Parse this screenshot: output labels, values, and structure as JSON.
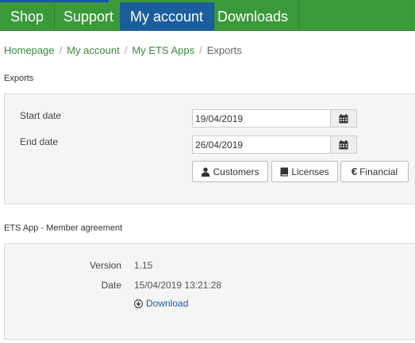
{
  "nav": {
    "items": [
      {
        "label": "Shop",
        "active": false
      },
      {
        "label": "Support",
        "active": false
      },
      {
        "label": "My account",
        "active": true
      },
      {
        "label": "Downloads",
        "active": false
      }
    ]
  },
  "breadcrumb": {
    "items": [
      "Homepage",
      "My account",
      "My ETS Apps"
    ],
    "separator": "/",
    "current": "Exports"
  },
  "exports": {
    "title": "Exports",
    "start_label": "Start date",
    "start_value": "19/04/2019",
    "end_label": "End date",
    "end_value": "26/04/2019",
    "buttons": {
      "customers": "Customers",
      "licenses": "Licenses",
      "financial": "Financial"
    }
  },
  "agreement": {
    "title": "ETS App - Member agreement",
    "version_label": "Version",
    "version_value": "1.15",
    "date_label": "Date",
    "date_value": "15/04/2019 13:21:28",
    "download_label": "Download"
  },
  "colors": {
    "nav_green": "#3a9a3a",
    "nav_active": "#1b5e9e",
    "link_green": "#3a8a3a",
    "link_blue": "#1a5fa8"
  }
}
